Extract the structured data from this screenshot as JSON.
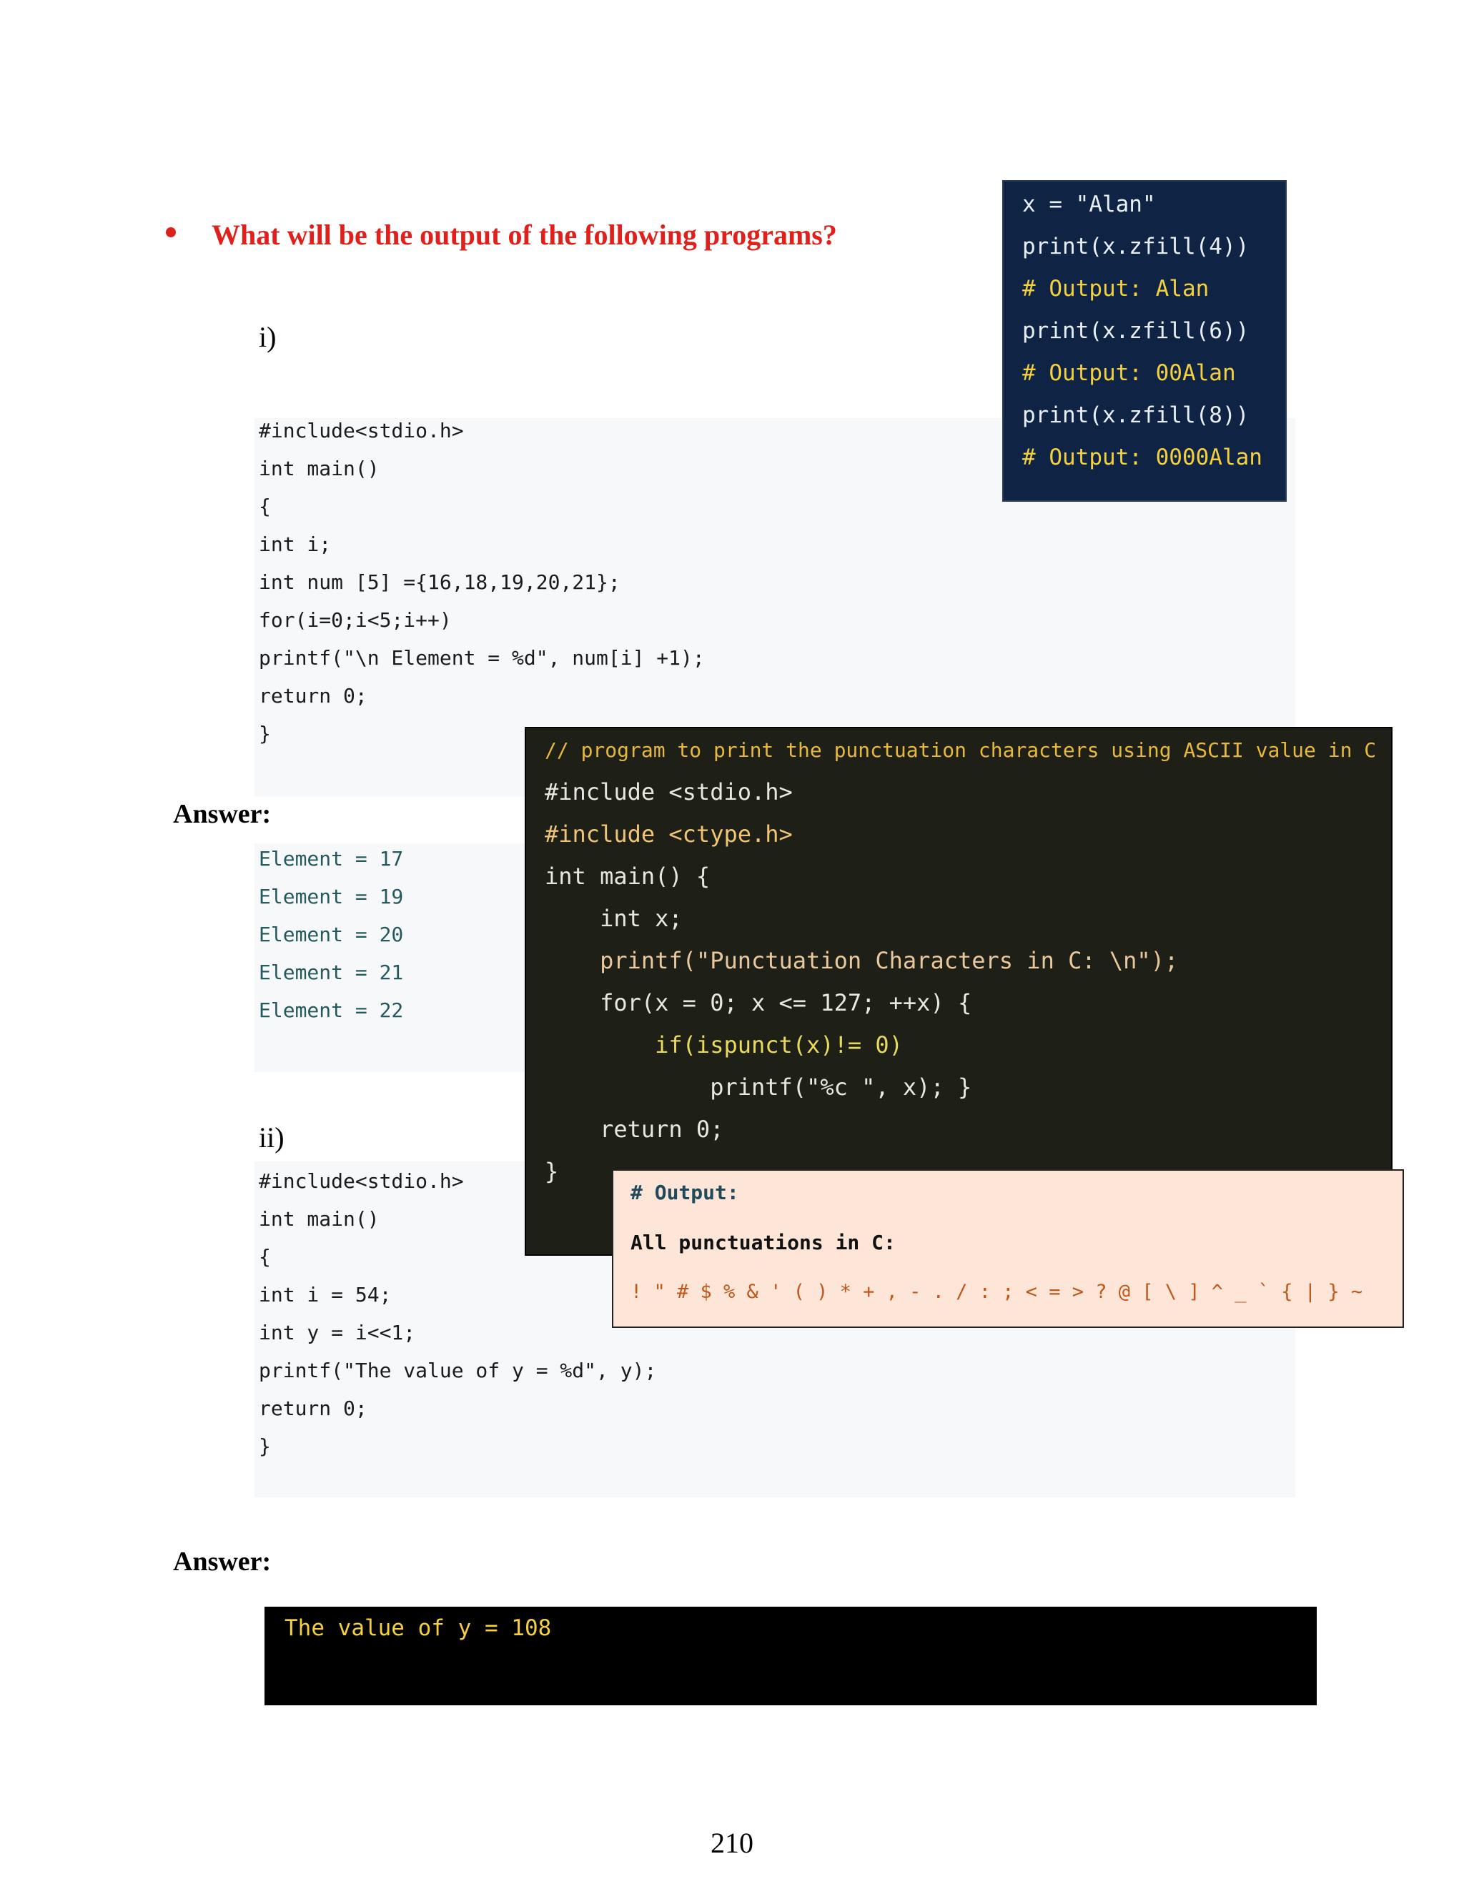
{
  "question": {
    "bullet": "•",
    "text": "What will be the output of the following programs?"
  },
  "program1": {
    "label": "i)",
    "code": [
      "#include<stdio.h>",
      "int main()",
      "{",
      "int i;",
      "int num [5] ={16,18,19,20,21};",
      "for(i=0;i<5;i++)",
      "printf(\"\\n Element = %d\", num[i] +1);",
      "return 0;",
      "}"
    ]
  },
  "answer1": {
    "label": "Answer:",
    "lines": [
      "Element = 17",
      "Element = 19",
      "Element = 20",
      "Element = 21",
      "Element = 22"
    ]
  },
  "program2": {
    "label": "ii)",
    "code": [
      "#include<stdio.h>",
      "int main()",
      "{",
      "int i = 54;",
      "int y = i<<1;",
      "printf(\"The value of y = %d\", y);",
      "return 0;",
      "}"
    ]
  },
  "answer2": {
    "label": "Answer:",
    "output": "The value of y = 108"
  },
  "python_box": {
    "lines": [
      "x = \"Alan\"",
      "print(x.zfill(4))",
      "# Output: Alan",
      "print(x.zfill(6))",
      "# Output: 00Alan",
      "print(x.zfill(8))",
      "# Output: 0000Alan"
    ]
  },
  "c_box": {
    "lines": [
      "// program to print the punctuation characters using ASCII value in C",
      "#include <stdio.h>",
      "#include <ctype.h>",
      "int main() {",
      "    int x;",
      "    printf(\"Punctuation Characters in C: \\n\");",
      "    for(x = 0; x <= 127; ++x) {",
      "        if(ispunct(x)!= 0)",
      "            printf(\"%c \", x); }",
      "    return 0;",
      "}"
    ]
  },
  "output_box": {
    "header": "# Output:",
    "title": "All punctuations in C:",
    "chars": "! \" # $ % & ' ( ) * + , - . / : ; < = > ? @ [ \\ ] ^ _ ` { | } ~"
  },
  "page_number": "210"
}
